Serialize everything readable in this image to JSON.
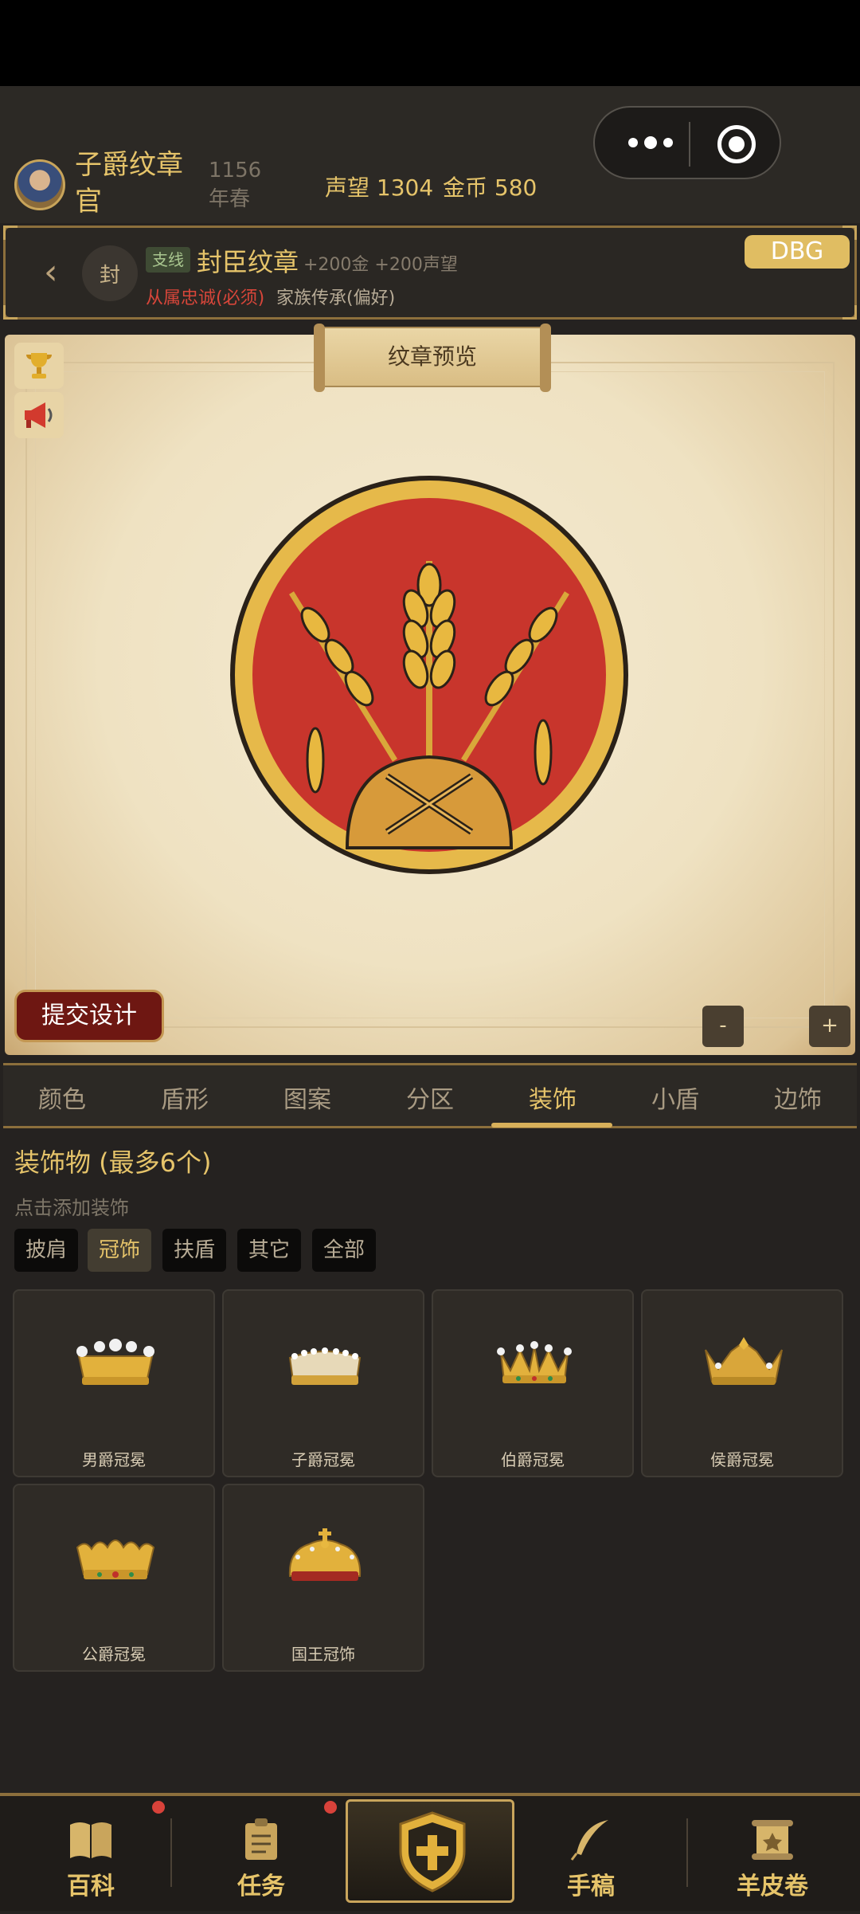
{
  "header": {
    "title": "子爵纹章官",
    "season": "1156年春",
    "reputation_label": "声望 1304",
    "gold_label": "金币 580"
  },
  "quest": {
    "seal": "封",
    "tag": "支线",
    "title": "封臣纹章",
    "reward": "+200金 +200声望",
    "requirement": "从属忠诚(必须)",
    "preference": "家族传承(偏好)",
    "debug_label": "DBG"
  },
  "preview": {
    "title": "纹章预览",
    "submit_label": "提交设计",
    "zoom_out": "-",
    "zoom_in": "+"
  },
  "tabs": [
    "颜色",
    "盾形",
    "图案",
    "分区",
    "装饰",
    "小盾",
    "边饰"
  ],
  "active_tab": "装饰",
  "decorations": {
    "title": "装饰物 (最多6个)",
    "hint": "点击添加装饰",
    "filters": [
      "披肩",
      "冠饰",
      "扶盾",
      "其它",
      "全部"
    ],
    "active_filter": "冠饰",
    "items": [
      {
        "label": "男爵冠冕"
      },
      {
        "label": "子爵冠冕"
      },
      {
        "label": "伯爵冠冕"
      },
      {
        "label": "侯爵冠冕"
      },
      {
        "label": "公爵冠冕"
      },
      {
        "label": "国王冠饰"
      }
    ]
  },
  "nav": [
    "百科",
    "任务",
    "手稿",
    "羊皮卷"
  ],
  "colors": {
    "gold": "#e6c46a",
    "field": "#c8352c",
    "border": "#8c6f3c",
    "badge_red": "#d8423a"
  }
}
